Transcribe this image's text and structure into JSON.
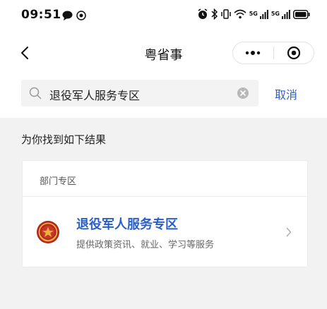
{
  "status_bar": {
    "time": "09:51",
    "network_1": "5G",
    "network_2": "5G"
  },
  "nav": {
    "title": "粤省事"
  },
  "search": {
    "value": "退役军人服务专区",
    "cancel_label": "取消"
  },
  "results": {
    "heading": "为你找到如下结果",
    "section_label": "部门专区",
    "items": [
      {
        "title": "退役军人服务专区",
        "description": "提供政策资讯、就业、学习等服务",
        "icon": "military-emblem-icon"
      }
    ]
  },
  "colors": {
    "accent": "#2a5fc9",
    "page_background": "#f2f2f2",
    "emblem_red": "#b3241e",
    "emblem_gold": "#e8b23a"
  }
}
